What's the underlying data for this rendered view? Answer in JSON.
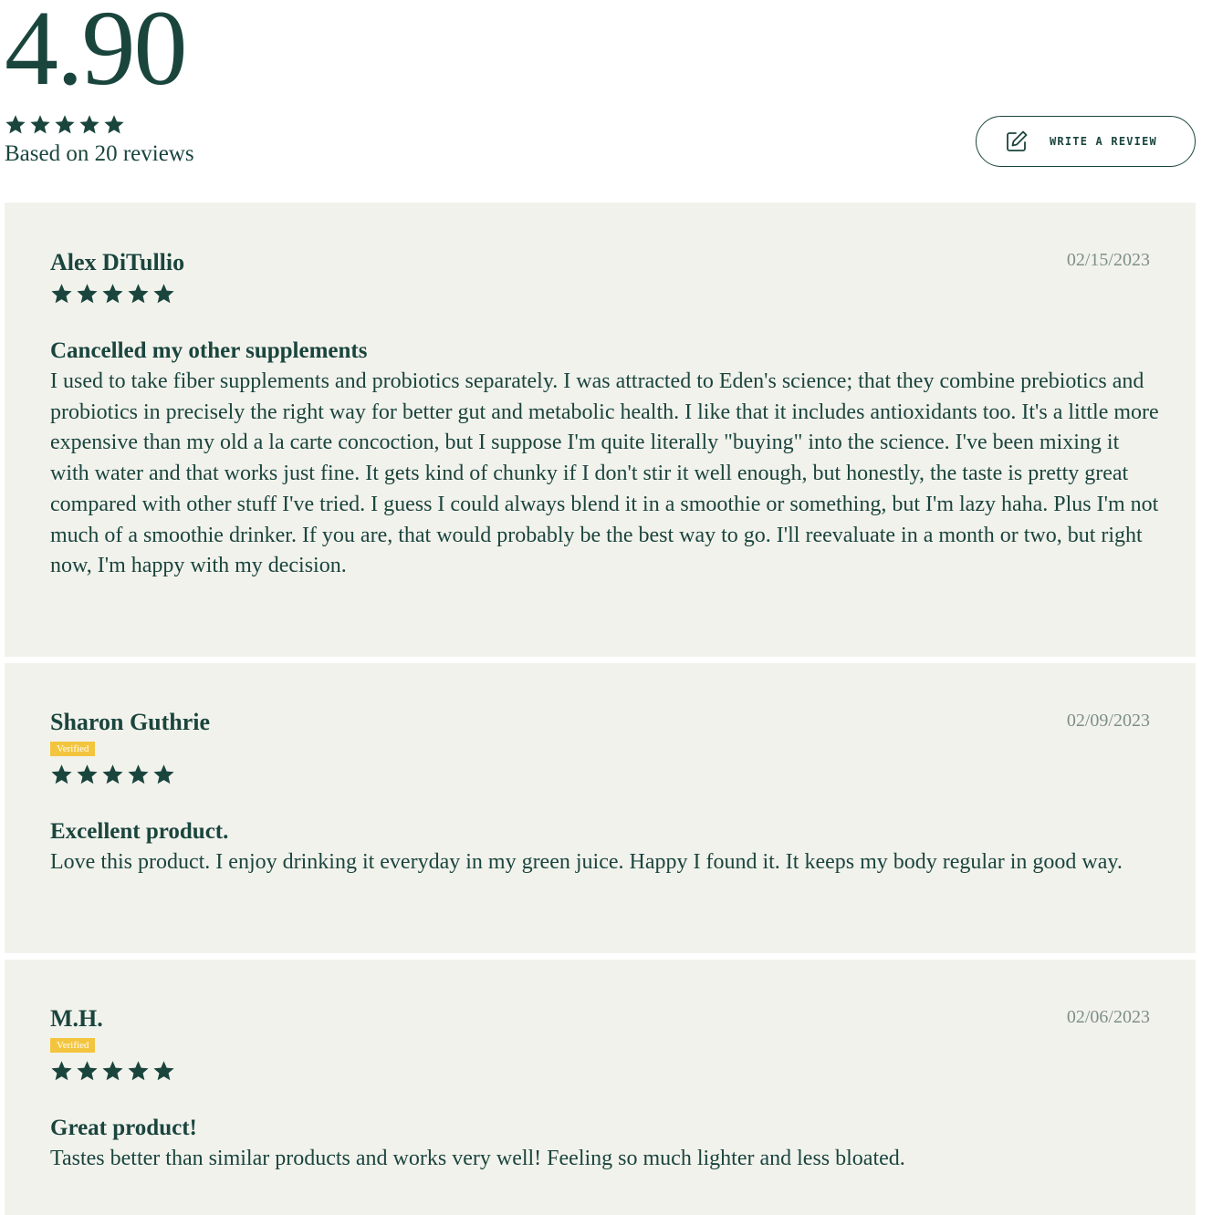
{
  "summary": {
    "average": "4.90",
    "rating": 5,
    "based_on": "Based on 20 reviews",
    "write_review_label": "WRITE A REVIEW",
    "write_icon": "edit-pen-icon"
  },
  "colors": {
    "brand": "#1a453d",
    "card_bg": "#f2f2ed",
    "verified_badge": "#f3c53e",
    "date_text": "#7d8f88"
  },
  "reviews": [
    {
      "author": "Alex DiTullio",
      "date": "02/15/2023",
      "verified": false,
      "rating": 5,
      "title": "Cancelled my other supplements",
      "body": "I used to take fiber supplements and probiotics separately. I was attracted to Eden's science; that they combine prebiotics and probiotics in precisely the right way for better gut and metabolic health. I like that it includes antioxidants too. It's a little more expensive than my old a la carte concoction, but I suppose I'm quite literally \"buying\" into the science. I've been mixing it with water and that works just fine. It gets kind of chunky if I don't stir it well enough, but honestly, the taste is pretty great compared with other stuff I've tried. I guess I could always blend it in a smoothie or something, but I'm lazy haha. Plus I'm not much of a smoothie drinker. If you are, that would probably be the best way to go. I'll reevaluate in a month or two, but right now, I'm happy with my decision."
    },
    {
      "author": "Sharon Guthrie",
      "date": "02/09/2023",
      "verified": true,
      "verified_label": "Verified",
      "rating": 5,
      "title": "Excellent product.",
      "body": "Love this product. I enjoy drinking it everyday in my green juice. Happy I found it. It keeps my body regular in good way."
    },
    {
      "author": "M.H.",
      "date": "02/06/2023",
      "verified": true,
      "verified_label": "Verified",
      "rating": 5,
      "title": "Great product!",
      "body": "Tastes better than similar products and works very well! Feeling so much lighter and less bloated."
    }
  ]
}
